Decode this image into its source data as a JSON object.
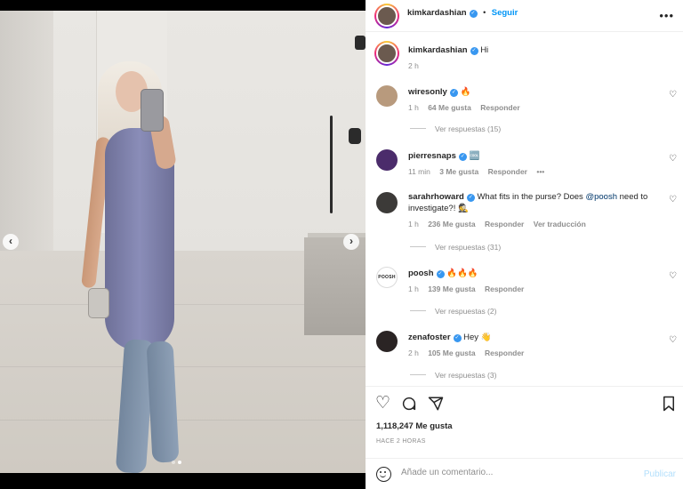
{
  "post": {
    "author": "kimkardashian",
    "follow_label": "Seguir",
    "more_glyph": "•••",
    "caption": "Hi",
    "caption_time": "2 h",
    "carousel": {
      "prev": "‹",
      "next": "›",
      "dot_count": 2,
      "active_index": 1
    }
  },
  "comments": [
    {
      "user": "wiresonly",
      "text": "🔥",
      "time": "1 h",
      "likes": "64 Me gusta",
      "reply": "Responder",
      "extra": "",
      "replies": "Ver respuestas (15)",
      "avatar_color": "#b89a7d"
    },
    {
      "user": "pierresnaps",
      "text": "🆒",
      "time": "11 min",
      "likes": "3 Me gusta",
      "reply": "Responder",
      "extra": "•••",
      "replies": "",
      "avatar_color": "#4b2c6b"
    },
    {
      "user": "sarahrhoward",
      "text_before": "What fits in the purse? Does ",
      "mention": "@poosh",
      "text_after": " need to investigate?! 🕵️",
      "time": "1 h",
      "likes": "236 Me gusta",
      "reply": "Responder",
      "extra": "Ver traducción",
      "replies": "Ver respuestas (31)",
      "avatar_color": "#3c3a38"
    },
    {
      "user": "poosh",
      "text": "🔥🔥🔥",
      "time": "1 h",
      "likes": "139 Me gusta",
      "reply": "Responder",
      "extra": "",
      "replies": "Ver respuestas (2)",
      "avatar_label": "POOSH",
      "avatar_color": "#ffffff"
    },
    {
      "user": "zenafoster",
      "text": "Hey 👋",
      "time": "2 h",
      "likes": "105 Me gusta",
      "reply": "Responder",
      "extra": "",
      "replies": "Ver respuestas (3)",
      "avatar_color": "#2a2424"
    }
  ],
  "footer": {
    "likes": "1,118,247 Me gusta",
    "ago": "HACE 2 HORAS",
    "comment_placeholder": "Añade un comentario...",
    "publish_label": "Publicar"
  },
  "colors": {
    "accent": "#0095f6",
    "verified": "#3897f0",
    "muted": "#8e8e8e"
  },
  "icons": [
    "heart-icon",
    "comment-icon",
    "share-icon",
    "bookmark-icon",
    "emoji-icon",
    "more-icon",
    "verified-icon"
  ]
}
